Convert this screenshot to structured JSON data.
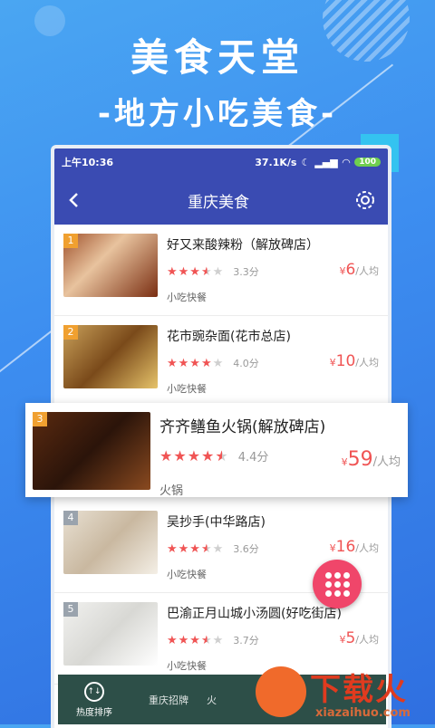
{
  "promo": {
    "title": "美食天堂",
    "subtitle": "-地方小吃美食-"
  },
  "status": {
    "time": "上午10:36",
    "speed": "37.1K/s",
    "battery": "100"
  },
  "nav": {
    "title": "重庆美食",
    "back_icon": "back-arrow-icon",
    "settings_icon": "gear-icon"
  },
  "items": [
    {
      "rank": "1",
      "name": "好又来酸辣粉（解放碑店）",
      "rating": 3.5,
      "score": "3.3分",
      "price": "6",
      "unit": "/人均",
      "category": "小吃快餐",
      "rank_color": "#f0a030"
    },
    {
      "rank": "2",
      "name": "花市豌杂面(花市总店)",
      "rating": 4,
      "score": "4.0分",
      "price": "10",
      "unit": "/人均",
      "category": "小吃快餐",
      "rank_color": "#f0a030"
    },
    {
      "rank": "4",
      "name": "吴抄手(中华路店)",
      "rating": 3.5,
      "score": "3.6分",
      "price": "16",
      "unit": "/人均",
      "category": "小吃快餐",
      "rank_color": "#9aa3ad"
    },
    {
      "rank": "5",
      "name": "巴渝正月山城小汤圆(好吃街店)",
      "rating": 3.5,
      "score": "3.7分",
      "price": "5",
      "unit": "/人均",
      "category": "小吃快餐",
      "rank_color": "#9aa3ad"
    }
  ],
  "featured": {
    "rank": "3",
    "name": "齐齐鳝鱼火锅(解放碑店)",
    "rating": 4.5,
    "score": "4.4分",
    "price": "59",
    "unit": "/人均",
    "category": "火锅",
    "rank_color": "#f0a030"
  },
  "currency": "¥",
  "bottom": {
    "tab1": "热度排序",
    "tab2": "重庆招牌",
    "tab3": "火"
  },
  "watermark": {
    "text": "下载火",
    "url": "xiazaihuo.com"
  },
  "colors": {
    "primary": "#3a4bb2",
    "accent": "#f05454",
    "fab": "#f0466a"
  }
}
